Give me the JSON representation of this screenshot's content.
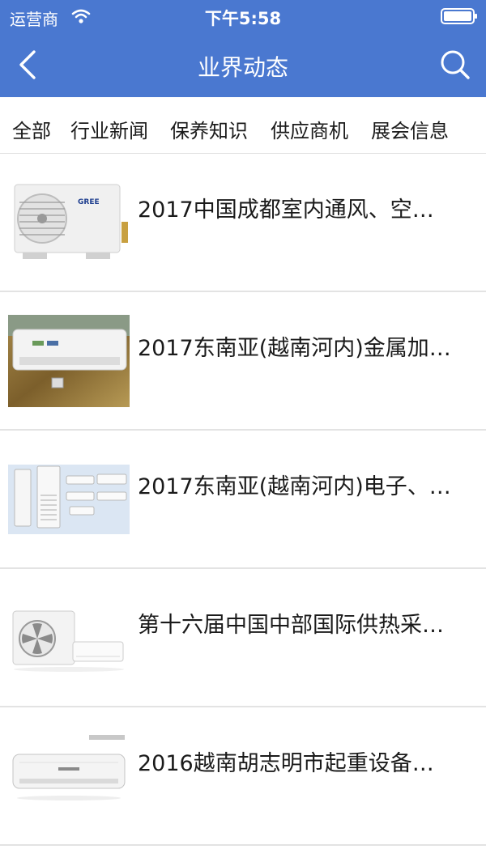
{
  "status": {
    "carrier": "运营商",
    "time": "下午5:58"
  },
  "nav": {
    "title": "业界动态"
  },
  "tabs": [
    "全部",
    "行业新闻",
    "保养知识",
    "供应商机",
    "展会信息"
  ],
  "news": [
    {
      "title": "2017中国成都室内通风、空…",
      "image": "gree-outdoor-ac-unit",
      "image_text": "GREE"
    },
    {
      "title": "2017东南亚(越南河内)金属加…",
      "image": "wall-mounted-ac-photo"
    },
    {
      "title": "2017东南亚(越南河内)电子、…",
      "image": "floor-and-wall-ac-units"
    },
    {
      "title": "第十六届中国中部国际供热采…",
      "image": "outdoor-unit-and-split-ac"
    },
    {
      "title": "2016越南胡志明市起重设备…",
      "image": "split-ac-indoor-unit"
    }
  ],
  "colors": {
    "header": "#4a78d0",
    "divider": "#e3e3e3"
  }
}
